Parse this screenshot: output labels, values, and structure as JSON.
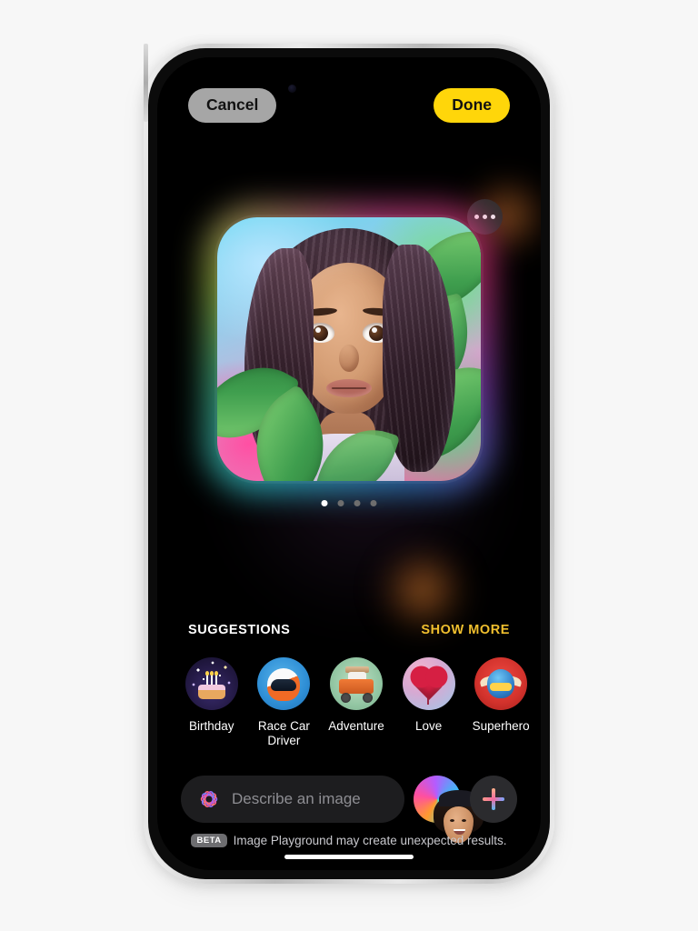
{
  "app": {
    "name": "Image Playground",
    "platform": "iPhone"
  },
  "top_bar": {
    "cancel_label": "Cancel",
    "done_label": "Done",
    "cancel_bg": "#a6a6a6",
    "done_bg": "#ffd60a"
  },
  "canvas": {
    "more_options_label": "More options",
    "image_description": "Animated-style portrait of a smiling young woman with long curly dark hair surrounded by green tropical leaves",
    "pages": [
      {
        "active": true
      },
      {
        "active": false
      },
      {
        "active": false
      },
      {
        "active": false
      }
    ],
    "page_count": 4,
    "active_page": 1
  },
  "suggestions": {
    "title": "SUGGESTIONS",
    "show_more_label": "SHOW MORE",
    "show_more_color": "#f0bf2e",
    "items": [
      {
        "label": "Birthday",
        "icon": "birthday-cake-icon"
      },
      {
        "label": "Race Car Driver",
        "icon": "racing-helmet-icon"
      },
      {
        "label": "Adventure",
        "icon": "off-road-truck-icon"
      },
      {
        "label": "Love",
        "icon": "heart-balloon-icon"
      },
      {
        "label": "Superhero",
        "icon": "superhero-mask-icon"
      }
    ]
  },
  "input_bar": {
    "placeholder": "Describe an image",
    "value": "",
    "ai_icon": "apple-intelligence-icon",
    "avatar_label": "Selected person",
    "add_label": "Add"
  },
  "disclaimer": {
    "badge": "BETA",
    "text": "Image Playground may create unexpected results."
  },
  "colors": {
    "page_background": "#f7f7f7",
    "screen_background": "#000000",
    "accent_yellow": "#ffd60a",
    "text_primary": "#ffffff",
    "text_secondary": "#8e8e93"
  }
}
